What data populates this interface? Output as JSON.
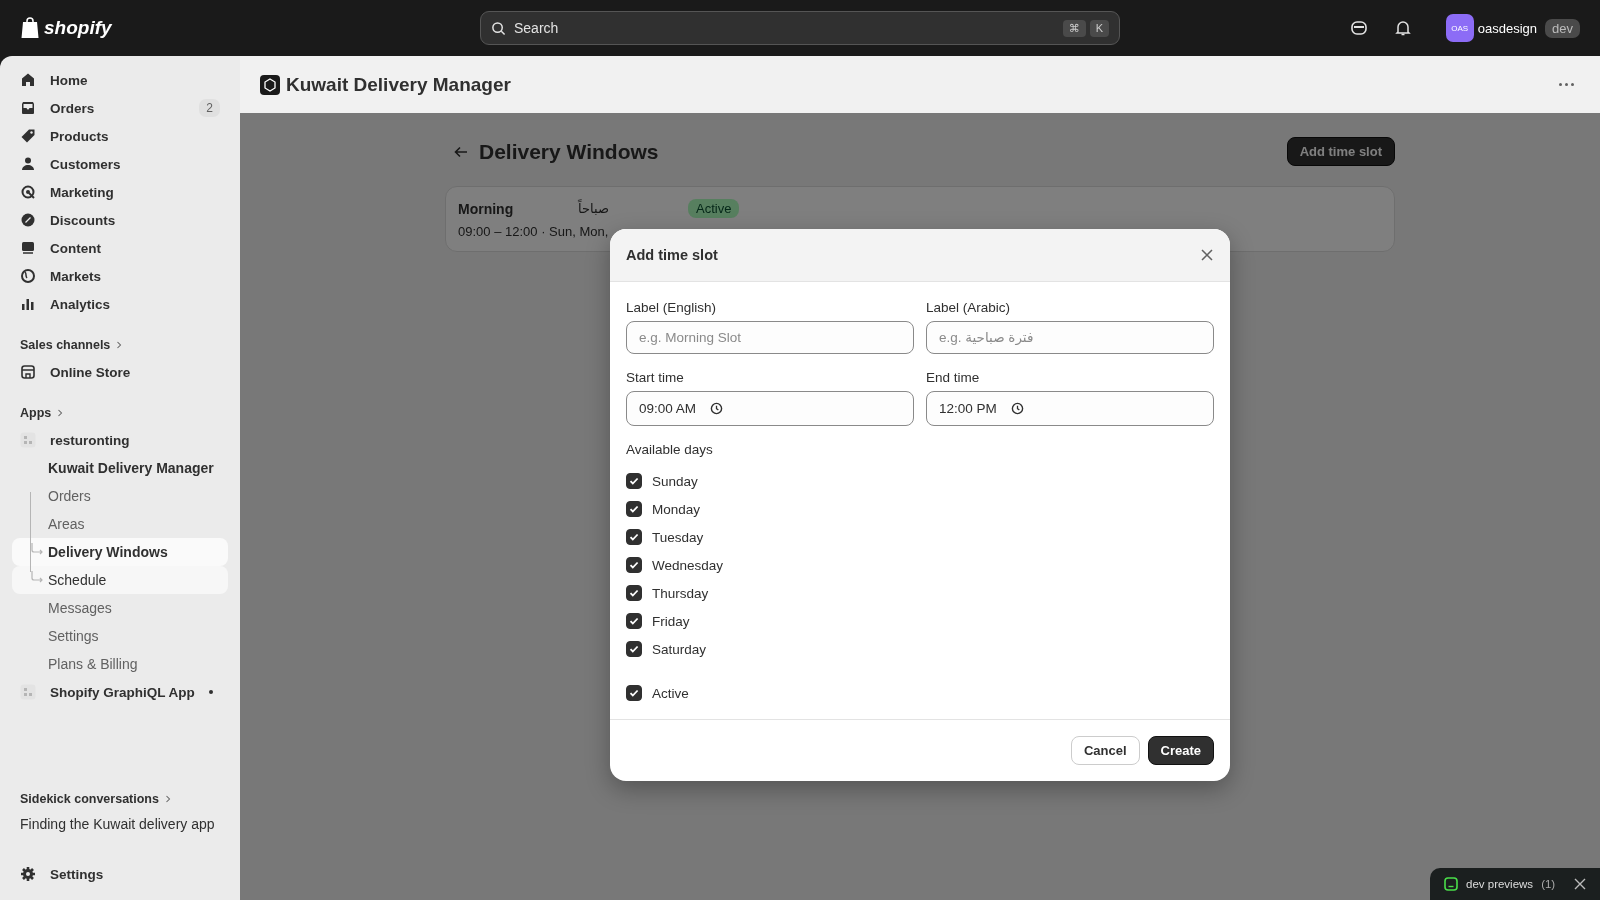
{
  "topbar": {
    "logo": "shopify",
    "search": {
      "placeholder": "Search",
      "keys": [
        "⌘",
        "K"
      ]
    },
    "user": {
      "initials": "OAS",
      "name": "oasdesign",
      "badge": "dev"
    }
  },
  "sidebar": {
    "items": [
      {
        "label": "Home"
      },
      {
        "label": "Orders",
        "badge": "2"
      },
      {
        "label": "Products"
      },
      {
        "label": "Customers"
      },
      {
        "label": "Marketing"
      },
      {
        "label": "Discounts"
      },
      {
        "label": "Content"
      },
      {
        "label": "Markets"
      },
      {
        "label": "Analytics"
      }
    ],
    "sales_channels": {
      "heading": "Sales channels",
      "items": [
        {
          "label": "Online Store"
        }
      ]
    },
    "apps": {
      "heading": "Apps",
      "items": [
        {
          "label": "resturonting",
          "dot": false,
          "children": [
            {
              "label": "Kuwait Delivery Manager",
              "kind": "app",
              "selected": false,
              "hovered": false
            },
            {
              "label": "Orders",
              "kind": "page",
              "selected": false,
              "hovered": false
            },
            {
              "label": "Areas",
              "kind": "page",
              "selected": false,
              "hovered": false
            },
            {
              "label": "Delivery Windows",
              "kind": "page",
              "selected": true,
              "hovered": false
            },
            {
              "label": "Schedule",
              "kind": "page",
              "selected": false,
              "hovered": true
            },
            {
              "label": "Messages",
              "kind": "page",
              "selected": false,
              "hovered": false
            },
            {
              "label": "Settings",
              "kind": "page",
              "selected": false,
              "hovered": false
            },
            {
              "label": "Plans & Billing",
              "kind": "page",
              "selected": false,
              "hovered": false
            }
          ]
        },
        {
          "label": "Shopify GraphiQL App",
          "dot": true
        }
      ]
    },
    "sidekick": {
      "heading": "Sidekick conversations",
      "items": [
        "Finding the Kuwait delivery app"
      ]
    },
    "settings": "Settings"
  },
  "app_header": {
    "title": "Kuwait Delivery Manager"
  },
  "page": {
    "title": "Delivery Windows",
    "primary_action": "Add time slot",
    "slots": [
      {
        "name": "Morning",
        "name_ar": "صباحاً",
        "status": "Active",
        "details": "09:00 – 12:00 · Sun, Mon,"
      }
    ]
  },
  "modal": {
    "title": "Add time slot",
    "fields": [
      {
        "label": "Label (English)",
        "placeholder": "e.g. Morning Slot",
        "kind": "text"
      },
      {
        "label": "Label (Arabic)",
        "placeholder": "e.g. فترة صباحية",
        "kind": "text"
      },
      {
        "label": "Start time",
        "value": "09:00 AM",
        "kind": "time"
      },
      {
        "label": "End time",
        "value": "12:00 PM",
        "kind": "time"
      }
    ],
    "days_label": "Available days",
    "days": [
      {
        "label": "Sunday",
        "checked": true
      },
      {
        "label": "Monday",
        "checked": true
      },
      {
        "label": "Tuesday",
        "checked": true
      },
      {
        "label": "Wednesday",
        "checked": true
      },
      {
        "label": "Thursday",
        "checked": true
      },
      {
        "label": "Friday",
        "checked": true
      },
      {
        "label": "Saturday",
        "checked": true
      }
    ],
    "active": {
      "label": "Active",
      "checked": true
    },
    "buttons": [
      {
        "label": "Cancel",
        "kind": "secondary"
      },
      {
        "label": "Create",
        "kind": "primary"
      }
    ]
  },
  "dev_previews": {
    "label": "dev previews",
    "count": "(1)"
  }
}
